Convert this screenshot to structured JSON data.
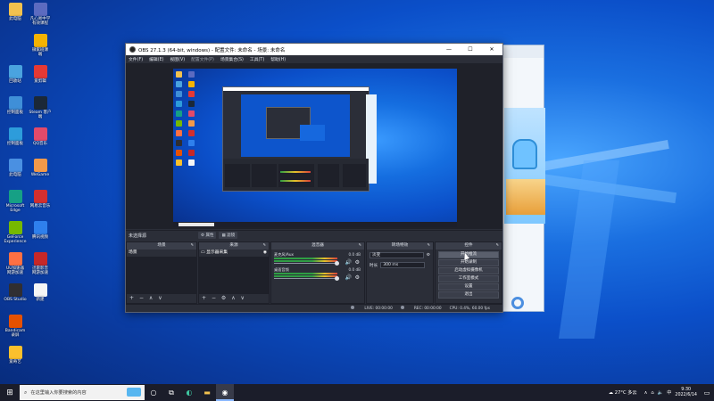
{
  "desktop": {
    "icons": [
      {
        "label": "此电脑",
        "color": "#f2c14e"
      },
      {
        "label": "凡心易中学\n有效课程",
        "color": "#5c6bc0"
      },
      {
        "label": "微家班课\n端",
        "color": "#f5b301"
      },
      {
        "label": "回收站",
        "color": "#4aa3df"
      },
      {
        "label": "爱剪辑",
        "color": "#e53935"
      },
      {
        "label": "控制面板",
        "color": "#3f8fd8"
      },
      {
        "label": "Steam 客户\n端",
        "color": "#1b2838"
      },
      {
        "label": "控制面板",
        "color": "#2d9cdb"
      },
      {
        "label": "QQ音乐",
        "color": "#e24a6a"
      },
      {
        "label": "此电脑",
        "color": "#4a90e2"
      },
      {
        "label": "WeGame",
        "color": "#f2994a"
      },
      {
        "label": "Microsoft\nEdge",
        "color": "#16a085"
      },
      {
        "label": "网易云音乐",
        "color": "#d32f2f"
      },
      {
        "label": "GeForce\nExperience",
        "color": "#76b900"
      },
      {
        "label": "腾讯视频",
        "color": "#2f80ed"
      },
      {
        "label": "UU加速器\n网游加速",
        "color": "#ff7043"
      },
      {
        "label": "迅雷影音\n网游加速",
        "color": "#c62828"
      },
      {
        "label": "OBS Studio",
        "color": "#302e31"
      },
      {
        "label": "新建",
        "color": "#f5f5f5"
      },
      {
        "label": "Bandicam\n录屏",
        "color": "#e65100"
      },
      {
        "label": "爱奇艺",
        "color": "#fbc02d"
      }
    ]
  },
  "obs": {
    "title": "OBS 27.1.3 (64-bit, windows) - 配置文件: 未命名 - 场景: 未命名",
    "window_controls": {
      "minimize": "—",
      "maximize": "☐",
      "close": "✕"
    },
    "menu": [
      "文件(F)",
      "编辑(E)",
      "视图(V)",
      "配置文件(P)",
      "场景集合(S)",
      "工具(T)",
      "帮助(H)"
    ],
    "scene_bar": {
      "label": "未选择源",
      "props_btn": "⚙ 属性",
      "filters_btn": "▦ 滤镜"
    },
    "docks": {
      "scenes": {
        "header": "场景",
        "items": [
          "场景"
        ]
      },
      "sources": {
        "header": "来源",
        "items": [
          "显示器采集"
        ]
      },
      "mixer": {
        "header": "混音器",
        "channels": [
          {
            "name": "麦克风/Aux",
            "db": "0.0 dB"
          },
          {
            "name": "桌面音频",
            "db": "0.0 dB"
          }
        ]
      },
      "transitions": {
        "header": "转场特效",
        "type": "淡变",
        "duration_label": "时长",
        "duration_value": "300 ms"
      },
      "controls": {
        "header": "控件",
        "buttons": [
          "开始推流",
          "开始录制",
          "启动虚拟摄像机",
          "工作室模式",
          "设置",
          "退出"
        ]
      }
    },
    "status": {
      "live": "LIVE: 00:00:00",
      "rec": "REC: 00:00:00",
      "cpu": "CPU: 0.4%, 60.00 fps"
    }
  },
  "taskbar": {
    "search_placeholder": "在这里输入你要搜索的内容",
    "weather": "27°C 多云",
    "time": "9:30",
    "date": "2022/6/14"
  }
}
